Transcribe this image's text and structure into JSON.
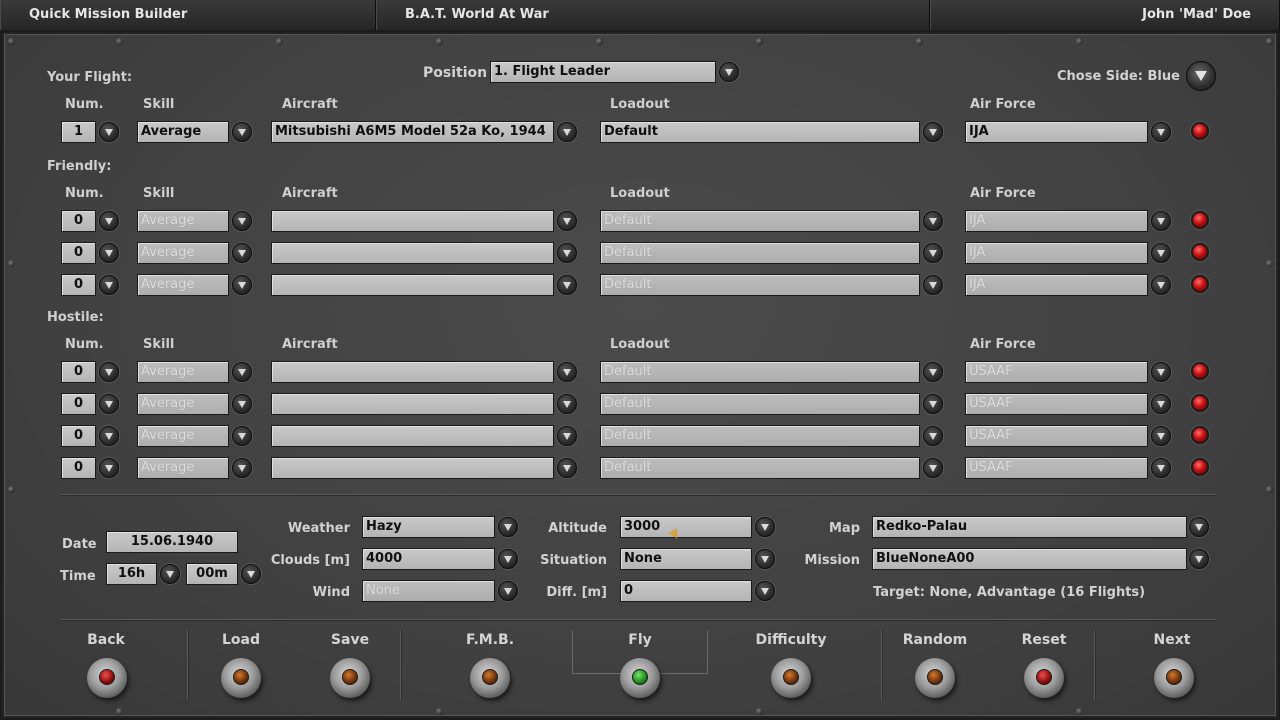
{
  "titlebar": {
    "left": "Quick Mission Builder",
    "center": "B.A.T. World At War",
    "right": "John 'Mad' Doe"
  },
  "your_flight": {
    "label": "Your Flight:",
    "position_label": "Position",
    "position_value": "1. Flight Leader",
    "side_label": "Chose Side: Blue",
    "headers": {
      "num": "Num.",
      "skill": "Skill",
      "aircraft": "Aircraft",
      "loadout": "Loadout",
      "air_force": "Air Force"
    },
    "row": {
      "num": "1",
      "skill": "Average",
      "aircraft": "Mitsubishi A6M5 Model 52a Ko, 1944",
      "loadout": "Default",
      "air_force": "IJA"
    }
  },
  "friendly": {
    "label": "Friendly:",
    "headers": {
      "num": "Num.",
      "skill": "Skill",
      "aircraft": "Aircraft",
      "loadout": "Loadout",
      "air_force": "Air Force"
    },
    "rows": [
      {
        "num": "0",
        "skill": "Average",
        "aircraft": "",
        "loadout": "Default",
        "air_force": "IJA"
      },
      {
        "num": "0",
        "skill": "Average",
        "aircraft": "",
        "loadout": "Default",
        "air_force": "IJA"
      },
      {
        "num": "0",
        "skill": "Average",
        "aircraft": "",
        "loadout": "Default",
        "air_force": "IJA"
      }
    ]
  },
  "hostile": {
    "label": "Hostile:",
    "headers": {
      "num": "Num.",
      "skill": "Skill",
      "aircraft": "Aircraft",
      "loadout": "Loadout",
      "air_force": "Air Force"
    },
    "rows": [
      {
        "num": "0",
        "skill": "Average",
        "aircraft": "",
        "loadout": "Default",
        "air_force": "USAAF"
      },
      {
        "num": "0",
        "skill": "Average",
        "aircraft": "",
        "loadout": "Default",
        "air_force": "USAAF"
      },
      {
        "num": "0",
        "skill": "Average",
        "aircraft": "",
        "loadout": "Default",
        "air_force": "USAAF"
      },
      {
        "num": "0",
        "skill": "Average",
        "aircraft": "",
        "loadout": "Default",
        "air_force": "USAAF"
      }
    ]
  },
  "settings": {
    "date_label": "Date",
    "date_value": "15.06.1940",
    "time_label": "Time",
    "hour": "16h",
    "minute": "00m",
    "weather_label": "Weather",
    "weather": "Hazy",
    "clouds_label": "Clouds [m]",
    "clouds": "4000",
    "wind_label": "Wind",
    "wind": "None",
    "altitude_label": "Altitude",
    "altitude": "3000",
    "situation_label": "Situation",
    "situation": "None",
    "diff_label": "Diff. [m]",
    "diff": "0",
    "map_label": "Map",
    "map": "Redko-Palau",
    "mission_label": "Mission",
    "mission": "BlueNoneA00",
    "target": "Target: None, Advantage (16 Flights)"
  },
  "nav": {
    "back": "Back",
    "load": "Load",
    "save": "Save",
    "fmb": "F.M.B.",
    "fly": "Fly",
    "difficulty": "Difficulty",
    "random": "Random",
    "reset": "Reset",
    "next": "Next"
  },
  "colors": {
    "panel": "#454545",
    "field": "#c0c0c0",
    "led_red": "#c41010",
    "fly_green": "#1c8a1a",
    "amber": "#6b2e08"
  }
}
